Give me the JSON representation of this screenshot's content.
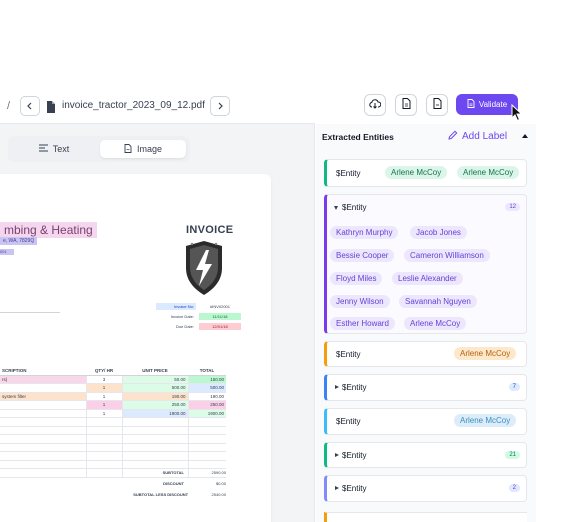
{
  "toolbar": {
    "separator": "/",
    "filename": "invoice_tractor_2023_09_12.pdf",
    "validate_label": "Validate"
  },
  "view_toggle": {
    "text_label": "Text",
    "image_label": "Image",
    "selected": "Image"
  },
  "document": {
    "company_name": "mbing & Heating",
    "company_address": "e, WA, 7829Q",
    "company_extra": "001",
    "invoice_title": "INVOICE",
    "meta": [
      {
        "label": "Invoice No:",
        "value": "#INV02001"
      },
      {
        "label": "Invoice Date:",
        "value": "11/11/18"
      },
      {
        "label": "Due Date:",
        "value": "12/01/18"
      }
    ],
    "table": {
      "headers": [
        "SCRIPTION",
        "QTY/ HR",
        "UNIT PRICE",
        "TOTAL"
      ],
      "rows": [
        [
          "rs)",
          "3",
          "50.00",
          "150.00"
        ],
        [
          "",
          "1",
          "500.00",
          "500.00"
        ],
        [
          "system filter",
          "1",
          "190.00",
          "190.00"
        ],
        [
          "",
          "1",
          "250.00",
          "250.00"
        ],
        [
          "",
          "1",
          "1900.00",
          "1900.00"
        ],
        [
          "",
          "",
          "",
          ""
        ],
        [
          "",
          "",
          "",
          ""
        ],
        [
          "",
          "",
          "",
          ""
        ],
        [
          "",
          "",
          "",
          ""
        ],
        [
          "",
          "",
          "",
          ""
        ],
        [
          "",
          "",
          "",
          ""
        ],
        [
          "",
          "",
          "",
          ""
        ]
      ]
    },
    "totals": [
      {
        "label": "SUBTOTAL",
        "value": "2590.00"
      },
      {
        "label": "DISCOUNT",
        "value": "$0.00"
      },
      {
        "label": "SUBTOTAL LESS DISCOUNT",
        "value": "2540.00"
      }
    ]
  },
  "entities_panel": {
    "title": "Extracted Entities",
    "add_label": "Add Label",
    "cards": [
      {
        "title": "$Entity",
        "chips": [
          "Arlene McCoy",
          "Arlene McCoy"
        ],
        "color": "#10b981"
      },
      {
        "title": "$Entity",
        "count": "12",
        "color": "#7c3aed",
        "expanded": true,
        "chips": [
          "Kathryn Murphy",
          "Jacob Jones",
          "Bessie Cooper",
          "Cameron Williamson",
          "Floyd Miles",
          "Leslie Alexander",
          "Jenny Wilson",
          "Savannah Nguyen",
          "Esther Howard",
          "Arlene McCoy"
        ]
      },
      {
        "title": "$Entity",
        "chips": [
          "Arlene McCoy"
        ],
        "color": "#f59e0b"
      },
      {
        "title": "$Entity",
        "count": "7",
        "color": "#3b82f6"
      },
      {
        "title": "$Entity",
        "chips": [
          "Arlene McCoy"
        ],
        "color": "#38bdf8"
      },
      {
        "title": "$Entity",
        "count": "21",
        "color": "#10b981"
      },
      {
        "title": "$Entity",
        "count": "2",
        "color": "#818cf8"
      }
    ]
  }
}
